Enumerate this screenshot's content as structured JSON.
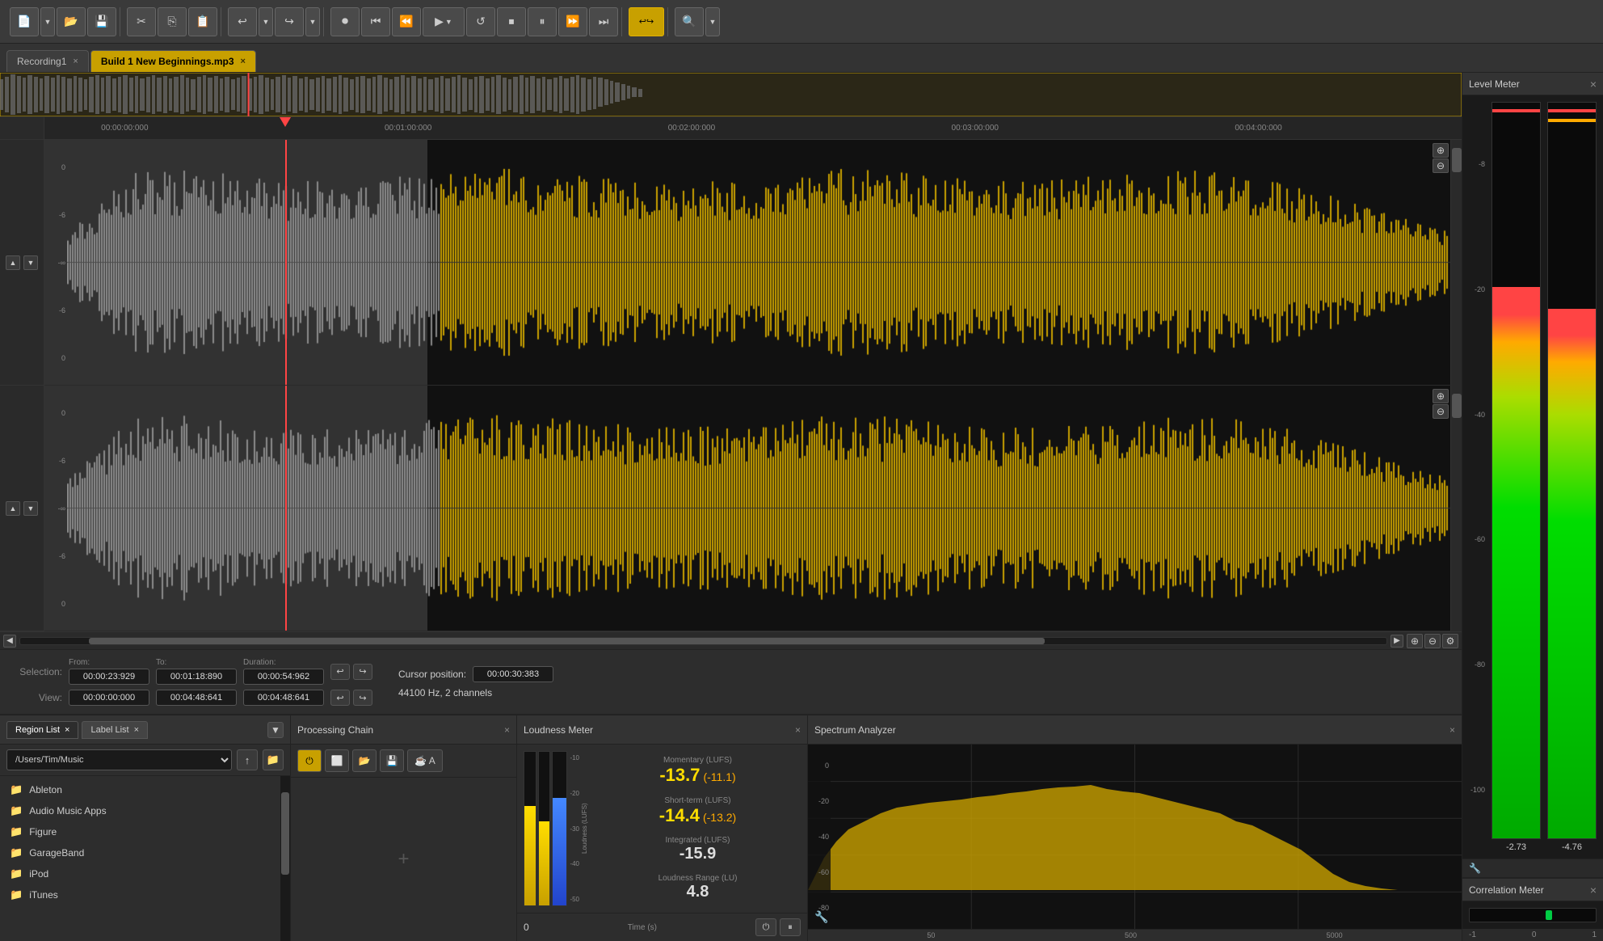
{
  "toolbar": {
    "buttons": [
      {
        "id": "new",
        "label": "📄",
        "tooltip": "New"
      },
      {
        "id": "new-dropdown",
        "label": "▼",
        "tooltip": "New dropdown"
      },
      {
        "id": "open",
        "label": "📂",
        "tooltip": "Open"
      },
      {
        "id": "save",
        "label": "💾",
        "tooltip": "Save"
      },
      {
        "id": "cut",
        "label": "✂",
        "tooltip": "Cut"
      },
      {
        "id": "copy",
        "label": "📋",
        "tooltip": "Copy"
      },
      {
        "id": "paste",
        "label": "📄",
        "tooltip": "Paste"
      },
      {
        "id": "undo",
        "label": "↩",
        "tooltip": "Undo"
      },
      {
        "id": "undo-dropdown",
        "label": "▼",
        "tooltip": "Undo dropdown"
      },
      {
        "id": "redo",
        "label": "↪",
        "tooltip": "Redo"
      },
      {
        "id": "redo-dropdown",
        "label": "▼",
        "tooltip": "Redo dropdown"
      },
      {
        "id": "record",
        "label": "⏺",
        "tooltip": "Record"
      },
      {
        "id": "skip-start",
        "label": "⏮",
        "tooltip": "Skip to start"
      },
      {
        "id": "rewind",
        "label": "⏪",
        "tooltip": "Rewind"
      },
      {
        "id": "play",
        "label": "▶",
        "tooltip": "Play"
      },
      {
        "id": "play-dropdown",
        "label": "▼",
        "tooltip": "Play dropdown"
      },
      {
        "id": "loop",
        "label": "🔁",
        "tooltip": "Loop"
      },
      {
        "id": "stop",
        "label": "⏹",
        "tooltip": "Stop"
      },
      {
        "id": "pause",
        "label": "⏸",
        "tooltip": "Pause"
      },
      {
        "id": "fast-forward",
        "label": "⏩",
        "tooltip": "Fast forward"
      },
      {
        "id": "skip-end",
        "label": "⏭",
        "tooltip": "Skip to end"
      },
      {
        "id": "loop-active",
        "label": "↩↪",
        "tooltip": "Loop region",
        "active": true
      },
      {
        "id": "search",
        "label": "🔍",
        "tooltip": "Search"
      },
      {
        "id": "search-dropdown",
        "label": "▼",
        "tooltip": "Search dropdown"
      }
    ]
  },
  "tabs": [
    {
      "id": "recording1",
      "label": "Recording1",
      "active": false,
      "closeable": true
    },
    {
      "id": "build1",
      "label": "Build 1 New Beginnings.mp3",
      "active": true,
      "closeable": true
    }
  ],
  "timeline": {
    "markers": [
      {
        "time": "00:00:00:000",
        "pos": "4%"
      },
      {
        "time": "00:01:00:000",
        "pos": "24%"
      },
      {
        "time": "00:02:00:000",
        "pos": "44%"
      },
      {
        "time": "00:03:00:000",
        "pos": "64%"
      },
      {
        "time": "00:04:00:000",
        "pos": "84%"
      }
    ]
  },
  "selection": {
    "label": "Selection:",
    "from_label": "From:",
    "to_label": "To:",
    "duration_label": "Duration:",
    "from_value": "00:00:23:929",
    "to_value": "00:01:18:890",
    "duration_value": "00:00:54:962",
    "cursor_label": "Cursor position:",
    "cursor_value": "00:00:30:383",
    "sample_info": "44100 Hz, 2 channels"
  },
  "view": {
    "label": "View:",
    "start_value": "00:00:00:000",
    "end_value": "00:04:48:641",
    "duration_value": "00:04:48:641"
  },
  "bottom_panels": {
    "region_list": {
      "title": "Region List",
      "close": "×"
    },
    "label_list": {
      "title": "Label List",
      "close": "×"
    },
    "path": "/Users/Tim/Music",
    "files": [
      {
        "name": "Ableton",
        "type": "folder"
      },
      {
        "name": "Audio Music Apps",
        "type": "folder"
      },
      {
        "name": "Figure",
        "type": "folder"
      },
      {
        "name": "GarageBand",
        "type": "folder"
      },
      {
        "name": "iPod",
        "type": "folder"
      },
      {
        "name": "iTunes",
        "type": "folder"
      }
    ]
  },
  "processing_chain": {
    "title": "Processing Chain",
    "close": "×",
    "add_btn": "+"
  },
  "loudness_meter": {
    "title": "Loudness Meter",
    "close": "×",
    "momentary_label": "Momentary (LUFS)",
    "momentary_value": "-13.7",
    "momentary_peak": "(-11.1)",
    "shortterm_label": "Short-term (LUFS)",
    "shortterm_value": "-14.4",
    "shortterm_peak": "(-13.2)",
    "integrated_label": "Integrated (LUFS)",
    "integrated_value": "-15.9",
    "range_label": "Loudness Range (LU)",
    "range_value": "4.8",
    "time_label": "Time (s)",
    "x_axis_0": "0"
  },
  "spectrum_analyzer": {
    "title": "Spectrum Analyzer",
    "close": "×",
    "y_labels": [
      "0",
      "-20",
      "-40",
      "-60",
      "-80"
    ],
    "x_labels": [
      "50",
      "500",
      "5000"
    ]
  },
  "level_meter": {
    "title": "Level Meter",
    "close": "×",
    "left_value": "-2.73",
    "right_value": "-4.76",
    "scale": [
      "-8",
      "-20",
      "-40",
      "-60",
      "-80",
      "-100"
    ]
  },
  "correlation_meter": {
    "title": "Correlation Meter",
    "close": "×",
    "labels": [
      "-1",
      "0",
      "1"
    ]
  }
}
